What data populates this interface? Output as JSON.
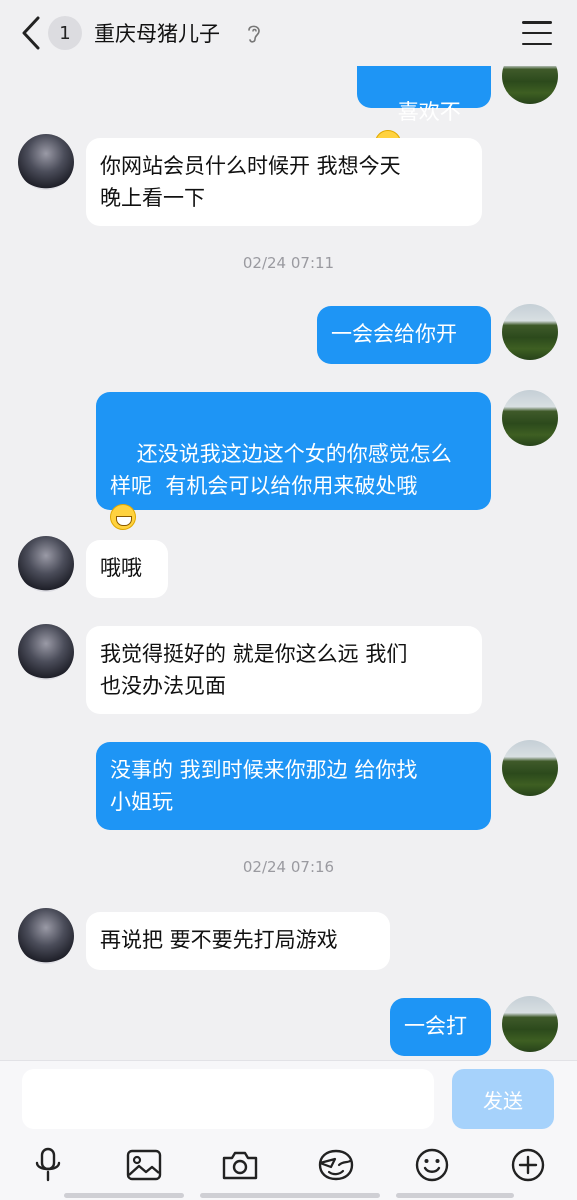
{
  "header": {
    "unread_count": "1",
    "title": "重庆母猪儿子"
  },
  "messages": [
    {
      "side": "out",
      "text": "喜欢不",
      "emoji": true
    },
    {
      "side": "in",
      "text": "你网站会员什么时候开 我想今天\n晚上看一下"
    },
    {
      "type": "time",
      "text": "02/24 07:11"
    },
    {
      "side": "out",
      "text": "一会会给你开"
    },
    {
      "side": "out",
      "text": "还没说我这边这个女的你感觉怎么\n样呢  有机会可以给你用来破处哦\n",
      "emoji": true
    },
    {
      "side": "in",
      "text": "哦哦"
    },
    {
      "side": "in",
      "text": "我觉得挺好的 就是你这么远 我们\n也没办法见面"
    },
    {
      "side": "out",
      "text": "没事的 我到时候来你那边 给你找\n小姐玩"
    },
    {
      "type": "time",
      "text": "02/24 07:16"
    },
    {
      "side": "in",
      "text": "再说把 要不要先打局游戏"
    },
    {
      "side": "out",
      "text": "一会打"
    }
  ],
  "input": {
    "value": "",
    "send_label": "发送"
  },
  "toolbar": {
    "icons": [
      "microphone-icon",
      "image-icon",
      "camera-icon",
      "sticker-icon",
      "emoji-icon",
      "plus-icon"
    ]
  },
  "colors": {
    "background": "#f0f0f2",
    "outgoing_bubble": "#1e95f5",
    "incoming_bubble": "#ffffff",
    "send_button": "#a6d2fb"
  }
}
